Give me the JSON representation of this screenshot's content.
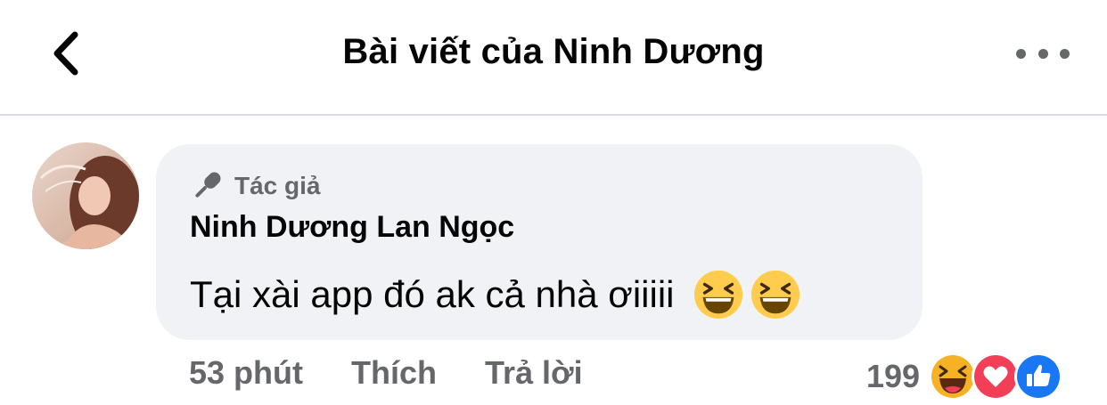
{
  "header": {
    "title": "Bài viết của Ninh Dương",
    "back_icon": "chevron-left-icon",
    "more_icon": "more-horizontal-icon"
  },
  "comment": {
    "author_badge": "Tác giả",
    "author_badge_icon": "microphone-icon",
    "author_name": "Ninh Dương Lan Ngọc",
    "text": "Tại xài app đó ak cả nhà ơiiiii",
    "emojis": [
      "laughing-emoji",
      "laughing-emoji"
    ],
    "time": "53 phút",
    "like_label": "Thích",
    "reply_label": "Trả lời",
    "reaction_count": "199",
    "reactions": [
      "haha-reaction-icon",
      "love-reaction-icon",
      "like-reaction-icon"
    ]
  },
  "colors": {
    "bubble": "#f0f2f5",
    "secondary_text": "#65676b",
    "like_blue": "#1877f2",
    "love_red": "#f33e58",
    "haha_yellow": "#f7b125"
  }
}
